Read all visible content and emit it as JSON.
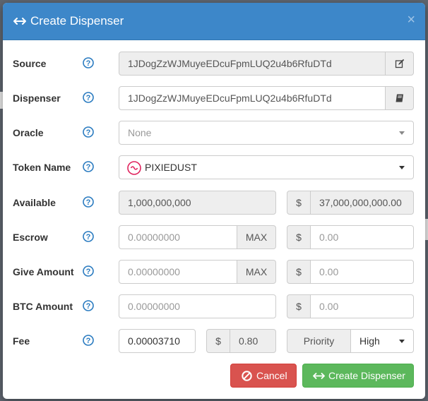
{
  "modal": {
    "title": "Create Dispenser",
    "close_label": "×"
  },
  "form": {
    "source": {
      "label": "Source",
      "value": "1JDogZzWJMuyeEDcuFpmLUQ2u4b6RfuDTd"
    },
    "dispenser": {
      "label": "Dispenser",
      "value": "1JDogZzWJMuyeEDcuFpmLUQ2u4b6RfuDTd"
    },
    "oracle": {
      "label": "Oracle",
      "selected": "None"
    },
    "token_name": {
      "label": "Token Name",
      "selected": "PIXIEDUST"
    },
    "available": {
      "label": "Available",
      "amount": "1,000,000,000",
      "currency_symbol": "$",
      "usd": "37,000,000,000.00"
    },
    "escrow": {
      "label": "Escrow",
      "placeholder": "0.00000000",
      "max_label": "MAX",
      "currency_symbol": "$",
      "usd_placeholder": "0.00"
    },
    "give_amount": {
      "label": "Give Amount",
      "placeholder": "0.00000000",
      "max_label": "MAX",
      "currency_symbol": "$",
      "usd_placeholder": "0.00"
    },
    "btc_amount": {
      "label": "BTC Amount",
      "placeholder": "0.00000000",
      "currency_symbol": "$",
      "usd_placeholder": "0.00"
    },
    "fee": {
      "label": "Fee",
      "value": "0.00003710",
      "currency_symbol": "$",
      "usd": "0.80",
      "priority_label": "Priority",
      "priority_selected": "High"
    }
  },
  "buttons": {
    "cancel": "Cancel",
    "create": "Create Dispenser"
  },
  "colors": {
    "header": "#3d87c9",
    "cancel": "#d9534f",
    "create": "#5cb85c",
    "help_icon": "#2a7bc0",
    "token_icon": "#e0245e"
  }
}
